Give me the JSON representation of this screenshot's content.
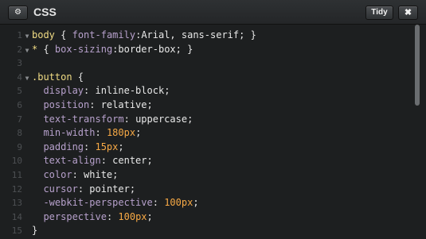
{
  "header": {
    "title": "CSS",
    "settings_icon": "gear-icon",
    "settings_glyph": "⚙",
    "tidy_label": "Tidy",
    "close_icon": "close-icon",
    "close_glyph": "✖"
  },
  "editor": {
    "lines": [
      {
        "n": "1",
        "fold": "▼",
        "parts": [
          [
            "sel",
            "body"
          ],
          [
            "punc",
            " { "
          ],
          [
            "prop",
            "font-family"
          ],
          [
            "punc",
            ":"
          ],
          [
            "val",
            "Arial, sans-serif"
          ],
          [
            "punc",
            "; }"
          ]
        ]
      },
      {
        "n": "2",
        "fold": "▼",
        "parts": [
          [
            "sel",
            "*"
          ],
          [
            "punc",
            " { "
          ],
          [
            "prop",
            "box-sizing"
          ],
          [
            "punc",
            ":"
          ],
          [
            "val",
            "border-box"
          ],
          [
            "punc",
            "; }"
          ]
        ]
      },
      {
        "n": "3",
        "fold": "",
        "parts": []
      },
      {
        "n": "4",
        "fold": "▼",
        "parts": [
          [
            "sel",
            ".button"
          ],
          [
            "punc",
            " {"
          ]
        ]
      },
      {
        "n": "5",
        "fold": "",
        "parts": [
          [
            "punc",
            "  "
          ],
          [
            "prop",
            "display"
          ],
          [
            "punc",
            ": "
          ],
          [
            "val",
            "inline-block"
          ],
          [
            "punc",
            ";"
          ]
        ]
      },
      {
        "n": "6",
        "fold": "",
        "parts": [
          [
            "punc",
            "  "
          ],
          [
            "prop",
            "position"
          ],
          [
            "punc",
            ": "
          ],
          [
            "val",
            "relative"
          ],
          [
            "punc",
            ";"
          ]
        ]
      },
      {
        "n": "7",
        "fold": "",
        "parts": [
          [
            "punc",
            "  "
          ],
          [
            "prop",
            "text-transform"
          ],
          [
            "punc",
            ": "
          ],
          [
            "val",
            "uppercase"
          ],
          [
            "punc",
            ";"
          ]
        ]
      },
      {
        "n": "8",
        "fold": "",
        "parts": [
          [
            "punc",
            "  "
          ],
          [
            "prop",
            "min-width"
          ],
          [
            "punc",
            ": "
          ],
          [
            "num",
            "180px"
          ],
          [
            "punc",
            ";"
          ]
        ]
      },
      {
        "n": "9",
        "fold": "",
        "parts": [
          [
            "punc",
            "  "
          ],
          [
            "prop",
            "padding"
          ],
          [
            "punc",
            ": "
          ],
          [
            "num",
            "15px"
          ],
          [
            "punc",
            ";"
          ]
        ]
      },
      {
        "n": "10",
        "fold": "",
        "parts": [
          [
            "punc",
            "  "
          ],
          [
            "prop",
            "text-align"
          ],
          [
            "punc",
            ": "
          ],
          [
            "val",
            "center"
          ],
          [
            "punc",
            ";"
          ]
        ]
      },
      {
        "n": "11",
        "fold": "",
        "parts": [
          [
            "punc",
            "  "
          ],
          [
            "prop",
            "color"
          ],
          [
            "punc",
            ": "
          ],
          [
            "val",
            "white"
          ],
          [
            "punc",
            ";"
          ]
        ]
      },
      {
        "n": "12",
        "fold": "",
        "parts": [
          [
            "punc",
            "  "
          ],
          [
            "prop",
            "cursor"
          ],
          [
            "punc",
            ": "
          ],
          [
            "val",
            "pointer"
          ],
          [
            "punc",
            ";"
          ]
        ]
      },
      {
        "n": "13",
        "fold": "",
        "parts": [
          [
            "punc",
            "  "
          ],
          [
            "prop",
            "-webkit-perspective"
          ],
          [
            "punc",
            ": "
          ],
          [
            "num",
            "100px"
          ],
          [
            "punc",
            ";"
          ]
        ]
      },
      {
        "n": "14",
        "fold": "",
        "parts": [
          [
            "punc",
            "  "
          ],
          [
            "prop",
            "perspective"
          ],
          [
            "punc",
            ": "
          ],
          [
            "num",
            "100px"
          ],
          [
            "punc",
            ";"
          ]
        ]
      },
      {
        "n": "15",
        "fold": "",
        "parts": [
          [
            "punc",
            "}"
          ]
        ]
      }
    ]
  },
  "colors": {
    "background": "#1d1f20",
    "selector": "#f1dc84",
    "property": "#b7a1cc",
    "value": "#e9e9e9",
    "number": "#f7a945",
    "line_number": "#4c4f52"
  }
}
